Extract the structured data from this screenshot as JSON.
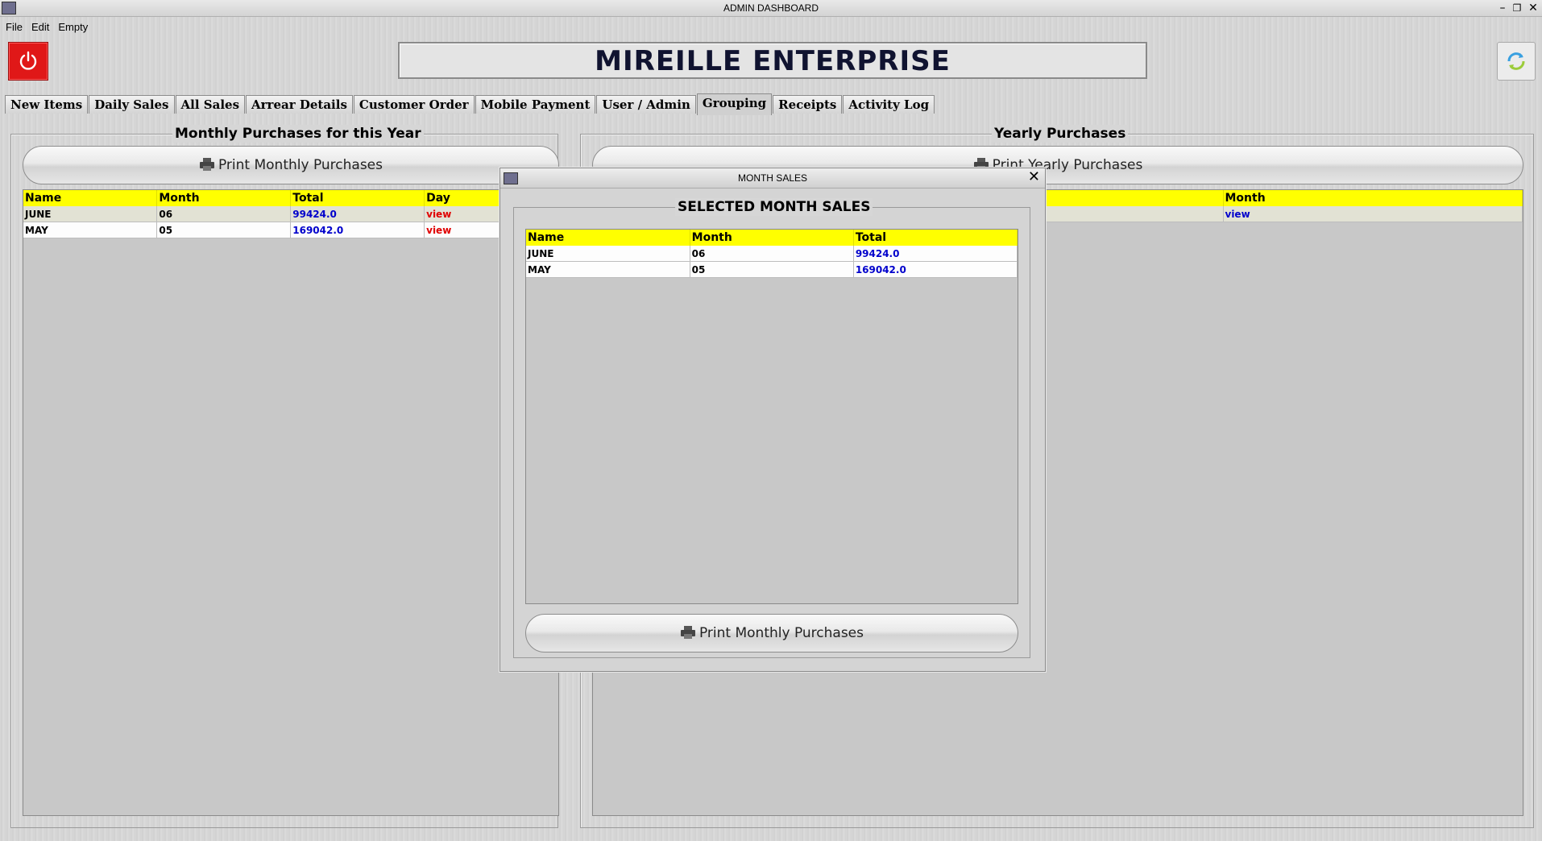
{
  "window": {
    "title": "ADMIN DASHBOARD",
    "minimize": "–",
    "maximize": "❐",
    "close": "✕"
  },
  "menu": [
    "File",
    "Edit",
    "Empty"
  ],
  "header": {
    "brand": "MIREILLE ENTERPRISE",
    "power_icon": "power-icon",
    "refresh_icon": "refresh-icon"
  },
  "tabs": [
    "New Items",
    "Daily Sales",
    "All Sales",
    "Arrear Details",
    "Customer Order",
    "Mobile Payment",
    "User / Admin",
    "Grouping",
    "Receipts",
    "Activity Log"
  ],
  "active_tab": "Grouping",
  "left_panel": {
    "title": "Monthly Purchases for this Year",
    "print_label": "Print Monthly Purchases",
    "columns": [
      "Name",
      "Month",
      "Total",
      "Day"
    ],
    "rows": [
      {
        "name": "JUNE",
        "month": "06",
        "total": "99424.0",
        "day": "view"
      },
      {
        "name": "MAY",
        "month": "05",
        "total": "169042.0",
        "day": "view"
      }
    ]
  },
  "right_panel": {
    "title": "Yearly Purchases",
    "print_label": "Print Yearly Purchases",
    "columns": [
      "Month"
    ],
    "rows": [
      {
        "month": "view"
      }
    ]
  },
  "dialog": {
    "title": "MONTH SALES",
    "close": "✕",
    "section_title": "SELECTED MONTH SALES",
    "columns": [
      "Name",
      "Month",
      "Total"
    ],
    "rows": [
      {
        "name": "JUNE",
        "month": "06",
        "total": "99424.0"
      },
      {
        "name": "MAY",
        "month": "05",
        "total": "169042.0"
      }
    ],
    "print_label": "Print Monthly Purchases"
  },
  "colors": {
    "header_yellow": "#ffff00",
    "value_blue": "#0000cc",
    "link_red": "#e00000",
    "power_red": "#e01818",
    "brand_text": "#101330"
  }
}
